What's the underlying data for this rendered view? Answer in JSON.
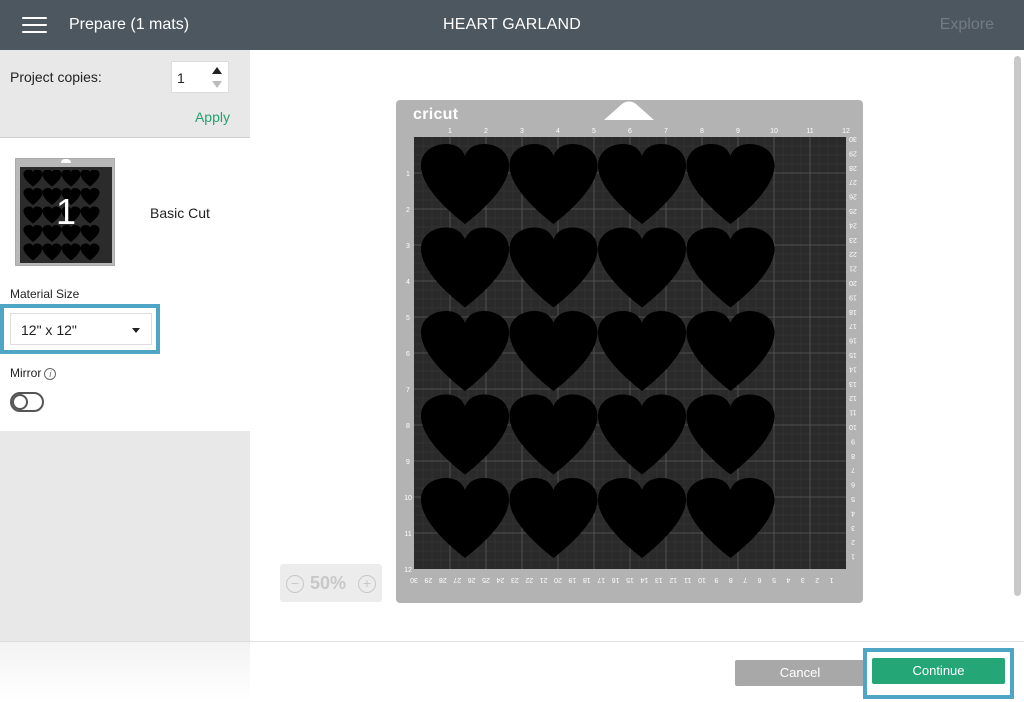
{
  "header": {
    "title": "Prepare (1 mats)",
    "project_name": "HEART GARLAND",
    "explore_label": "Explore"
  },
  "left_panel": {
    "copies_label": "Project copies:",
    "copies_value": "1",
    "apply_label": "Apply",
    "mat": {
      "number": "1",
      "label": "Basic Cut"
    },
    "material_size_label": "Material Size",
    "material_size_value": "12\" x 12\"",
    "mirror_label": "Mirror",
    "mirror_info": "i",
    "mirror_on": false
  },
  "canvas": {
    "brand": "cricut",
    "zoom": {
      "minus": "−",
      "value": "50%",
      "plus": "+"
    },
    "heart_rows": 5,
    "heart_cols": 4
  },
  "footer": {
    "cancel_label": "Cancel",
    "continue_label": "Continue"
  },
  "colors": {
    "header_bg": "#4d575f",
    "accent_green": "#24a676",
    "highlight_blue": "#4fa6c4",
    "mat_gray": "#b3b3b3",
    "grid_dark": "#2a2a2a"
  }
}
